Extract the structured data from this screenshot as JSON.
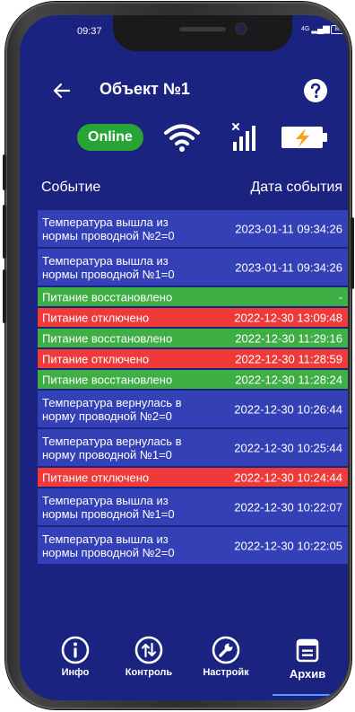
{
  "status_bar": {
    "time": "09:37",
    "network": "4G",
    "battery": "80"
  },
  "header": {
    "title": "Объект №1"
  },
  "indicators": {
    "online_label": "Online"
  },
  "table": {
    "col_event": "Событие",
    "col_date": "Дата события"
  },
  "events": [
    {
      "event": "Температура вышла из\nнормы проводной №2=0",
      "date": "2023-01-11 09:34:26",
      "kind": "info"
    },
    {
      "event": "Температура вышла из\nнормы проводной №1=0",
      "date": "2023-01-11 09:34:26",
      "kind": "info"
    },
    {
      "event": "Питание восстановлено",
      "date": "-",
      "kind": "ok"
    },
    {
      "event": "Питание отключено",
      "date": "2022-12-30 13:09:48",
      "kind": "err"
    },
    {
      "event": "Питание восстановлено",
      "date": "2022-12-30 11:29:16",
      "kind": "ok"
    },
    {
      "event": "Питание отключено",
      "date": "2022-12-30 11:28:59",
      "kind": "err"
    },
    {
      "event": "Питание восстановлено",
      "date": "2022-12-30 11:28:24",
      "kind": "ok"
    },
    {
      "event": "Температура вернулась в\nнорму проводной №2=0",
      "date": "2022-12-30 10:26:44",
      "kind": "info"
    },
    {
      "event": "Температура вернулась в\nнорму проводной №1=0",
      "date": "2022-12-30 10:25:44",
      "kind": "info"
    },
    {
      "event": "Питание отключено",
      "date": "2022-12-30 10:24:44",
      "kind": "err"
    },
    {
      "event": "Температура вышла из\nнормы проводной №1=0",
      "date": "2022-12-30 10:22:07",
      "kind": "info"
    },
    {
      "event": "Температура вышла из\nнормы проводной №2=0",
      "date": "2022-12-30 10:22:05",
      "kind": "info"
    }
  ],
  "nav": {
    "info": "Инфо",
    "control": "Контроль",
    "settings": "Настройк",
    "archive": "Архив",
    "active": "archive"
  },
  "colors": {
    "background": "#1b2381",
    "row_info": "#3340b6",
    "row_ok": "#3fae44",
    "row_err": "#ef3a3a",
    "online": "#27a534",
    "battery_bolt": "#f6a21a",
    "nav_active": "#4e9cff"
  },
  "icons": {
    "back": "arrow-left-icon",
    "help": "help-circle-icon",
    "wifi": "wifi-icon",
    "signal": "cellular-signal-icon",
    "battery": "battery-charging-icon",
    "info": "info-circle-icon",
    "control": "control-arrows-icon",
    "settings": "wrench-icon",
    "archive": "calendar-icon"
  }
}
